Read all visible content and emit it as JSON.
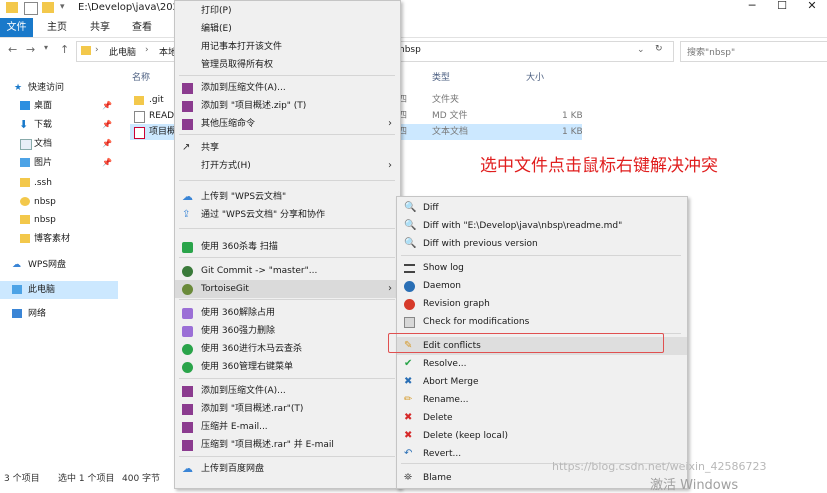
{
  "window": {
    "title": "E:\\Develop\\java\\2020",
    "controls": [
      "─",
      "☐",
      "✕"
    ]
  },
  "ribbon": {
    "file_tab": "文件",
    "tabs": [
      "主页",
      "共享",
      "查看"
    ]
  },
  "address": {
    "crumbs": [
      "此电脑",
      "本地",
      "nbsp"
    ],
    "search_placeholder": "搜索\"nbsp\""
  },
  "sidebar": {
    "items": [
      {
        "label": "快速访问",
        "icon": "star-icon"
      },
      {
        "label": "桌面",
        "icon": "desktop-icon",
        "pinned": true
      },
      {
        "label": "下载",
        "icon": "download-icon",
        "pinned": true
      },
      {
        "label": "文档",
        "icon": "document-icon",
        "pinned": true
      },
      {
        "label": "图片",
        "icon": "picture-icon",
        "pinned": true
      },
      {
        "label": ".ssh",
        "icon": "folder-icon"
      },
      {
        "label": "nbsp",
        "icon": "git-folder-icon"
      },
      {
        "label": "nbsp",
        "icon": "folder-icon"
      },
      {
        "label": "博客素材",
        "icon": "folder-icon"
      },
      {
        "label": "WPS网盘",
        "icon": "cloud-icon"
      },
      {
        "label": "此电脑",
        "icon": "computer-icon"
      },
      {
        "label": "网络",
        "icon": "network-icon"
      }
    ]
  },
  "files": {
    "columns": {
      "name": "名称",
      "type": "类型",
      "size": "大小"
    },
    "rows": [
      {
        "name": ".git",
        "date": "四",
        "type": "文件夹",
        "size": ""
      },
      {
        "name": "READ",
        "date": "四",
        "type": "MD 文件",
        "size": "1 KB"
      },
      {
        "name": "项目概",
        "date": "四",
        "type": "文本文档",
        "size": "1 KB"
      }
    ]
  },
  "status": {
    "count": "3 个项目",
    "selected": "选中 1 个项目",
    "size": "400 字节"
  },
  "context_menu": {
    "items": [
      {
        "label": "打印(P)"
      },
      {
        "label": "编辑(E)"
      },
      {
        "label": "用记事本打开该文件"
      },
      {
        "label": "管理员取得所有权"
      },
      {
        "label": "添加到压缩文件(A)...",
        "icon": "winrar-icon"
      },
      {
        "label": "添加到 \"项目概述.zip\" (T)",
        "icon": "winrar-icon"
      },
      {
        "label": "其他压缩命令",
        "icon": "winrar-icon",
        "submenu": true
      },
      {
        "label": "共享",
        "icon": "share-icon"
      },
      {
        "label": "打开方式(H)",
        "submenu": true
      },
      {
        "label": "上传到 \"WPS云文档\"",
        "icon": "wps-cloud-icon"
      },
      {
        "label": "通过 \"WPS云文档\" 分享和协作",
        "icon": "wps-share-icon"
      },
      {
        "label": "使用 360杀毒 扫描",
        "icon": "shield-360-icon"
      },
      {
        "label": "Git Commit -> \"master\"...",
        "icon": "git-commit-icon"
      },
      {
        "label": "TortoiseGit",
        "icon": "tortoisegit-icon",
        "submenu": true
      },
      {
        "label": "使用 360解除占用",
        "icon": "unlock-360-icon"
      },
      {
        "label": "使用 360强力删除",
        "icon": "delete-360-icon"
      },
      {
        "label": "使用 360进行木马云查杀",
        "icon": "scan-360-icon"
      },
      {
        "label": "使用 360管理右键菜单",
        "icon": "menu-360-icon"
      },
      {
        "label": "添加到压缩文件(A)...",
        "icon": "winrar-icon"
      },
      {
        "label": "添加到 \"项目概述.rar\"(T)",
        "icon": "winrar-icon"
      },
      {
        "label": "压缩并 E-mail...",
        "icon": "winrar-icon"
      },
      {
        "label": "压缩到 \"项目概述.rar\" 并 E-mail",
        "icon": "winrar-icon"
      },
      {
        "label": "上传到百度网盘",
        "icon": "baidu-cloud-icon"
      }
    ]
  },
  "submenu": {
    "items": [
      {
        "label": "Diff",
        "icon": "diff-icon"
      },
      {
        "label": "Diff with \"E:\\Develop\\java\\nbsp\\readme.md\"",
        "icon": "diff-icon"
      },
      {
        "label": "Diff with previous version",
        "icon": "diff-icon"
      },
      {
        "label": "Show log",
        "icon": "log-icon"
      },
      {
        "label": "Daemon",
        "icon": "daemon-icon"
      },
      {
        "label": "Revision graph",
        "icon": "graph-icon"
      },
      {
        "label": "Check for modifications",
        "icon": "check-icon"
      },
      {
        "label": "Edit conflicts",
        "icon": "edit-conflicts-icon",
        "highlighted": true
      },
      {
        "label": "Resolve...",
        "icon": "resolve-icon"
      },
      {
        "label": "Abort Merge",
        "icon": "abort-icon"
      },
      {
        "label": "Rename...",
        "icon": "rename-icon"
      },
      {
        "label": "Delete",
        "icon": "delete-icon"
      },
      {
        "label": "Delete (keep local)",
        "icon": "delete-icon"
      },
      {
        "label": "Revert...",
        "icon": "revert-icon"
      },
      {
        "label": "Blame",
        "icon": "blame-icon"
      }
    ]
  },
  "annotation": "选中文件点击鼠标右键解决冲突",
  "watermark": "https://blog.csdn.net/weixin_42586723",
  "activate_text": "激活 Windows"
}
